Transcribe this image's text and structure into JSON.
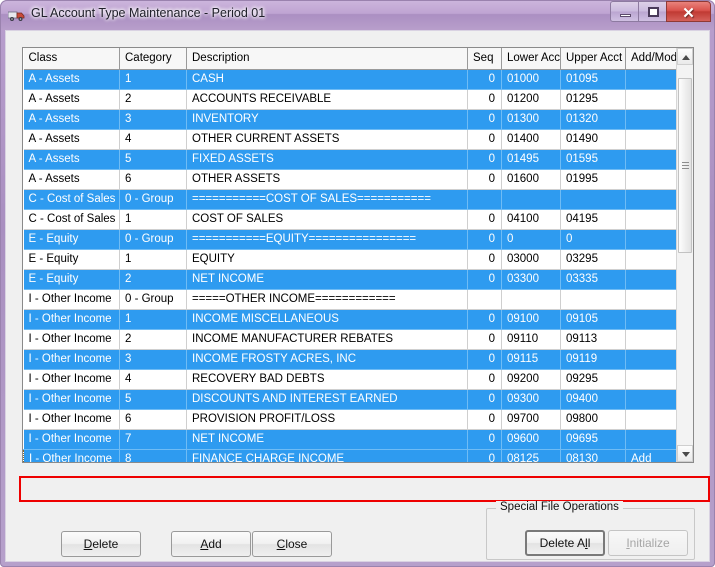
{
  "window": {
    "title": "GL Account Type Maintenance - Period 01",
    "icon": "truck-icon",
    "minimize_label": "",
    "maximize_label": "",
    "close_label": "✕",
    "frame_color": "#b29ac8",
    "titlebar_color": "#bfa4d2",
    "close_button_color": "#d9524c"
  },
  "grid": {
    "columns": [
      "Class",
      "Category",
      "Description",
      "Seq",
      "Lower Acct",
      "Upper Acct",
      "Add/Mod"
    ],
    "selection_color": "#2e9bf0",
    "rows": [
      {
        "class": "A - Assets",
        "category": "1",
        "description": "CASH",
        "seq": "0",
        "lower": "01000",
        "upper": "01095",
        "addmod": "",
        "selected": true,
        "focused": false
      },
      {
        "class": "A - Assets",
        "category": "2",
        "description": "ACCOUNTS RECEIVABLE",
        "seq": "0",
        "lower": "01200",
        "upper": "01295",
        "addmod": "",
        "selected": false,
        "focused": false
      },
      {
        "class": "A - Assets",
        "category": "3",
        "description": "INVENTORY",
        "seq": "0",
        "lower": "01300",
        "upper": "01320",
        "addmod": "",
        "selected": true,
        "focused": false
      },
      {
        "class": "A - Assets",
        "category": "4",
        "description": "OTHER CURRENT ASSETS",
        "seq": "0",
        "lower": "01400",
        "upper": "01490",
        "addmod": "",
        "selected": false,
        "focused": false
      },
      {
        "class": "A - Assets",
        "category": "5",
        "description": "FIXED ASSETS",
        "seq": "0",
        "lower": "01495",
        "upper": "01595",
        "addmod": "",
        "selected": true,
        "focused": false
      },
      {
        "class": "A - Assets",
        "category": "6",
        "description": "OTHER ASSETS",
        "seq": "0",
        "lower": "01600",
        "upper": "01995",
        "addmod": "",
        "selected": false,
        "focused": false
      },
      {
        "class": "C - Cost of Sales",
        "category": "0 - Group",
        "description": "===========COST OF SALES===========",
        "seq": "",
        "lower": "",
        "upper": "",
        "addmod": "",
        "selected": true,
        "focused": false
      },
      {
        "class": "C - Cost of Sales",
        "category": "1",
        "description": "COST OF SALES",
        "seq": "0",
        "lower": "04100",
        "upper": "04195",
        "addmod": "",
        "selected": false,
        "focused": false
      },
      {
        "class": "E - Equity",
        "category": "0 - Group",
        "description": "===========EQUITY================",
        "seq": "0",
        "lower": "0",
        "upper": "0",
        "addmod": "",
        "selected": true,
        "focused": false
      },
      {
        "class": "E - Equity",
        "category": "1",
        "description": "EQUITY",
        "seq": "0",
        "lower": "03000",
        "upper": "03295",
        "addmod": "",
        "selected": false,
        "focused": false
      },
      {
        "class": "E - Equity",
        "category": "2",
        "description": "NET INCOME",
        "seq": "0",
        "lower": "03300",
        "upper": "03335",
        "addmod": "",
        "selected": true,
        "focused": false
      },
      {
        "class": "I - Other Income",
        "category": "0 - Group",
        "description": "=====OTHER INCOME============",
        "seq": "",
        "lower": "",
        "upper": "",
        "addmod": "",
        "selected": false,
        "focused": false
      },
      {
        "class": "I - Other Income",
        "category": "1",
        "description": "INCOME MISCELLANEOUS",
        "seq": "0",
        "lower": "09100",
        "upper": "09105",
        "addmod": "",
        "selected": true,
        "focused": false
      },
      {
        "class": "I - Other Income",
        "category": "2",
        "description": "INCOME MANUFACTURER REBATES",
        "seq": "0",
        "lower": "09110",
        "upper": "09113",
        "addmod": "",
        "selected": false,
        "focused": false
      },
      {
        "class": "I - Other Income",
        "category": "3",
        "description": "INCOME FROSTY ACRES, INC",
        "seq": "0",
        "lower": "09115",
        "upper": "09119",
        "addmod": "",
        "selected": true,
        "focused": false
      },
      {
        "class": "I - Other Income",
        "category": "4",
        "description": "RECOVERY BAD DEBTS",
        "seq": "0",
        "lower": "09200",
        "upper": "09295",
        "addmod": "",
        "selected": false,
        "focused": false
      },
      {
        "class": "I - Other Income",
        "category": "5",
        "description": "DISCOUNTS AND INTEREST EARNED",
        "seq": "0",
        "lower": "09300",
        "upper": "09400",
        "addmod": "",
        "selected": true,
        "focused": false
      },
      {
        "class": "I - Other Income",
        "category": "6",
        "description": "PROVISION PROFIT/LOSS",
        "seq": "0",
        "lower": "09700",
        "upper": "09800",
        "addmod": "",
        "selected": false,
        "focused": false
      },
      {
        "class": "I - Other Income",
        "category": "7",
        "description": "NET INCOME",
        "seq": "0",
        "lower": "09600",
        "upper": "09695",
        "addmod": "",
        "selected": true,
        "focused": false
      },
      {
        "class": "I - Other Income",
        "category": "8",
        "description": "FINANCE CHARGE INCOME",
        "seq": "0",
        "lower": "08125",
        "upper": "08130",
        "addmod": "Add",
        "selected": true,
        "focused": true
      }
    ]
  },
  "scrollbar": {
    "up_arrow": "scroll-up-icon",
    "down_arrow": "scroll-down-icon"
  },
  "annotation": {
    "highlight_color": "#ee0000"
  },
  "buttons": {
    "delete": {
      "pre": "D",
      "post": "elete"
    },
    "add": {
      "pre": "A",
      "post": "dd"
    },
    "close": {
      "pre": "C",
      "post": "lose"
    }
  },
  "special_ops": {
    "title": "Special File Operations",
    "delete_all": {
      "pre": "Delete A",
      "mid": "l",
      "post": "l"
    },
    "initialize": {
      "pre": "I",
      "post": "nitialize"
    }
  }
}
